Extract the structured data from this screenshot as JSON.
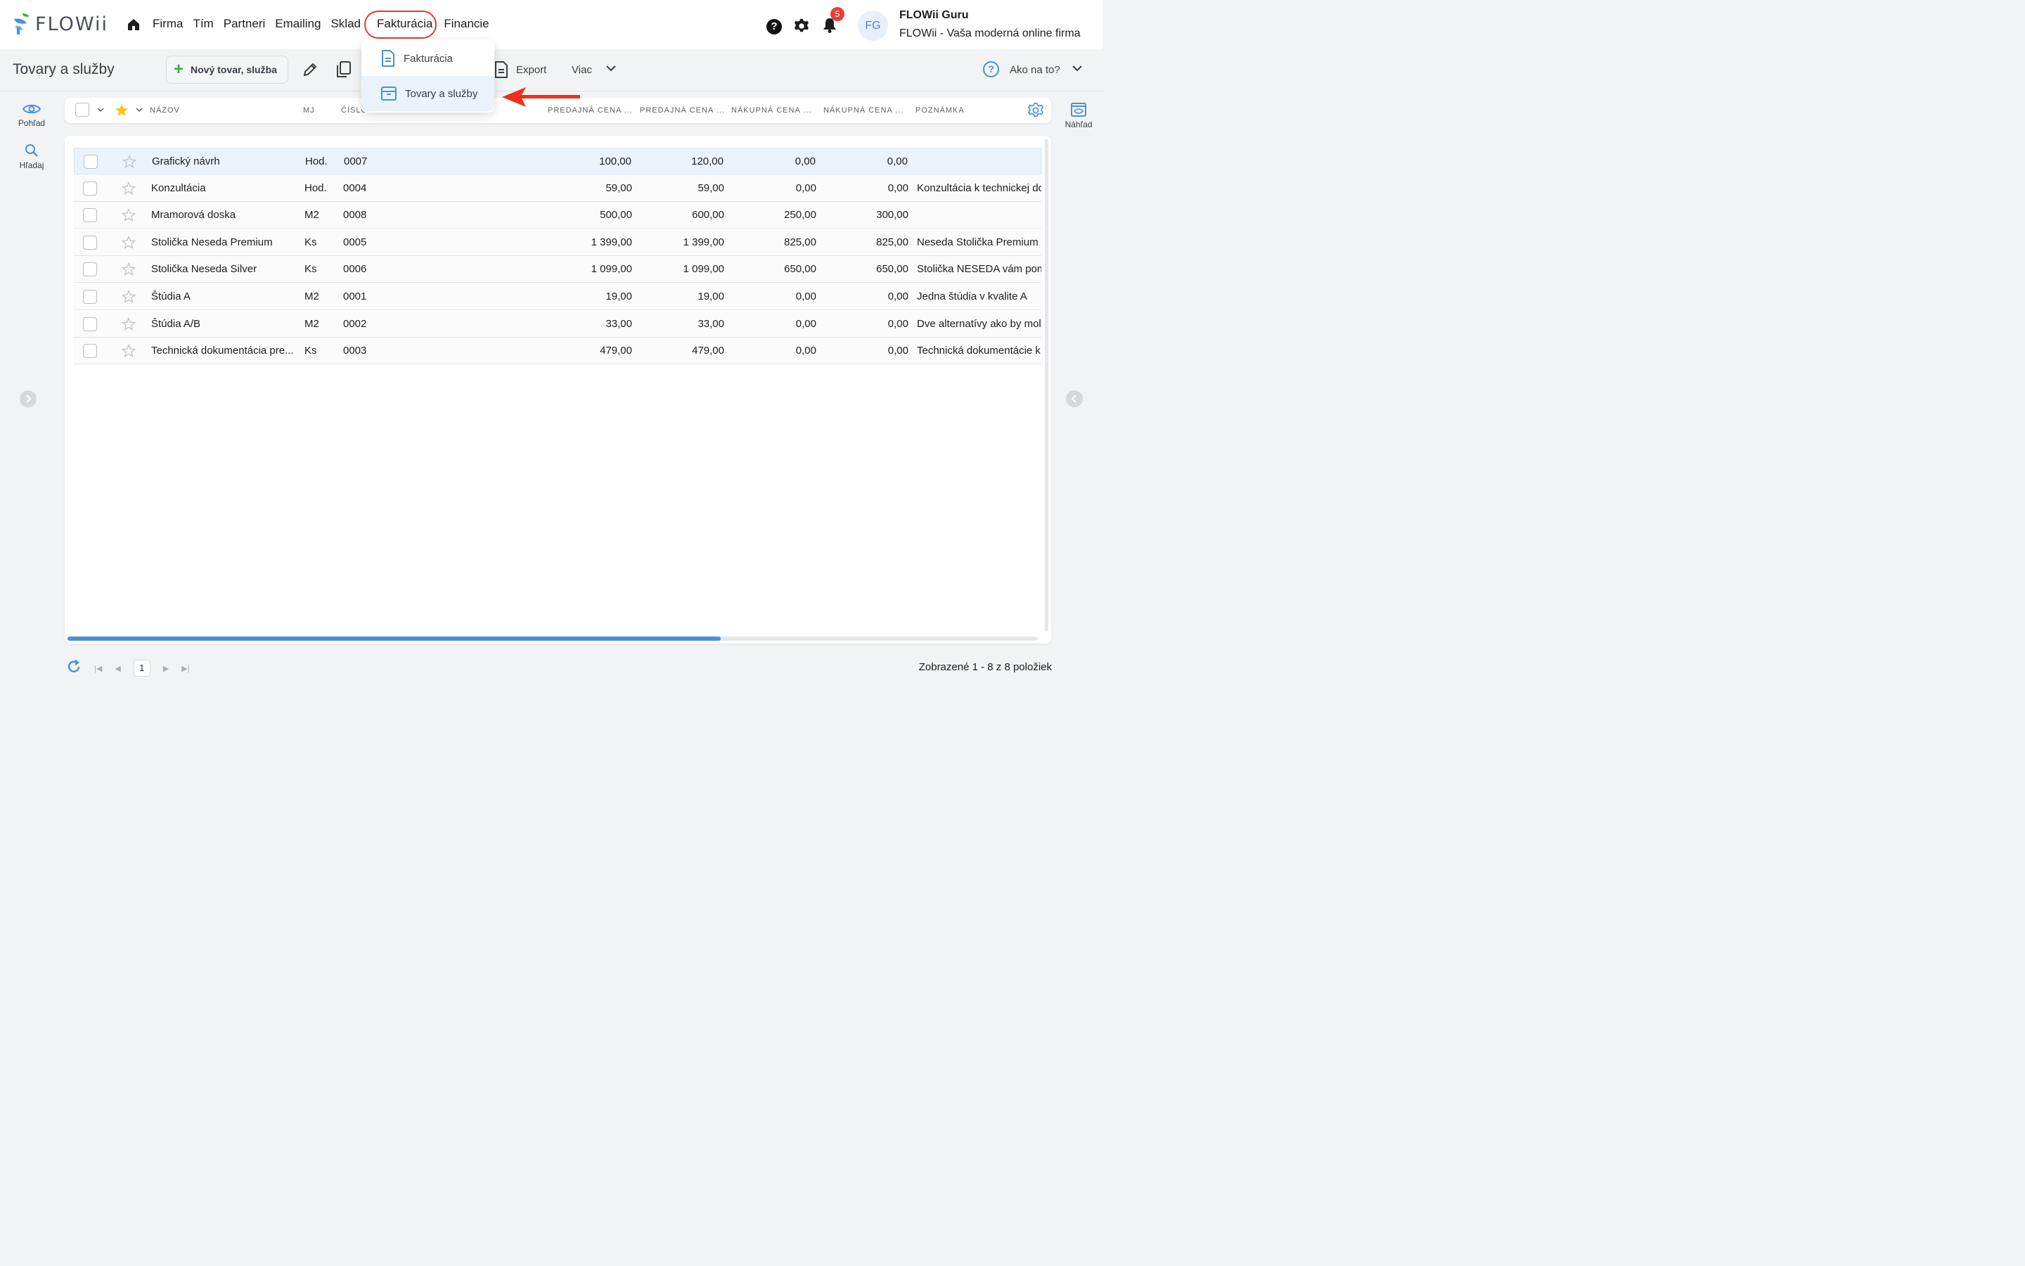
{
  "app": {
    "logo_text": "FLOWii",
    "nav": [
      "Firma",
      "Tím",
      "Partneri",
      "Emailing",
      "Sklad",
      "Fakturácia",
      "Financie"
    ],
    "help_label": "?",
    "notifications_count": "5",
    "avatar_initials": "FG",
    "user_name": "FLOWii Guru",
    "user_company": "FLOWii - Vaša moderná online firma"
  },
  "toolbar": {
    "title": "Tovary a služby",
    "new_label": "Nový tovar, služba",
    "export_label": "Export",
    "more_label": "Viac",
    "howto_label": "Ako na to?",
    "howto_icon": "?"
  },
  "dropdown": {
    "items": [
      "Fakturácia",
      "Tovary a služby"
    ]
  },
  "side": {
    "view_label": "Pohľad",
    "search_label": "Hľadaj",
    "preview_label": "Náhľad"
  },
  "table": {
    "headers": {
      "name": "NÁZOV",
      "unit": "MJ",
      "number": "ČÍSLO",
      "price1": "PREDAJNÁ CENA ...",
      "price2": "PREDAJNÁ CENA ...",
      "buy1": "NÁKUPNÁ CENA ...",
      "buy2": "NÁKUPNÁ CENA ...",
      "note": "POZNÁMKA"
    },
    "rows": [
      {
        "name": "Grafický návrh",
        "unit": "Hod.",
        "number": "0007",
        "p1": "100,00",
        "p2": "120,00",
        "b1": "0,00",
        "b2": "0,00",
        "note": ""
      },
      {
        "name": "Konzultácia",
        "unit": "Hod.",
        "number": "0004",
        "p1": "59,00",
        "p2": "59,00",
        "b1": "0,00",
        "b2": "0,00",
        "note": "Konzultácia k technickej do"
      },
      {
        "name": "Mramorová doska",
        "unit": "M2",
        "number": "0008",
        "p1": "500,00",
        "p2": "600,00",
        "b1": "250,00",
        "b2": "300,00",
        "note": ""
      },
      {
        "name": "Stolička Neseda Premium",
        "unit": "Ks",
        "number": "0005",
        "p1": "1 399,00",
        "p2": "1 399,00",
        "b1": "825,00",
        "b2": "825,00",
        "note": "Neseda Stolička Premium -"
      },
      {
        "name": "Stolička Neseda Silver",
        "unit": "Ks",
        "number": "0006",
        "p1": "1 099,00",
        "p2": "1 099,00",
        "b1": "650,00",
        "b2": "650,00",
        "note": "Stolička NESEDA vám pom"
      },
      {
        "name": "Štúdia A",
        "unit": "M2",
        "number": "0001",
        "p1": "19,00",
        "p2": "19,00",
        "b1": "0,00",
        "b2": "0,00",
        "note": "Jedna štúdia v kvalite A"
      },
      {
        "name": "Štúdia A/B",
        "unit": "M2",
        "number": "0002",
        "p1": "33,00",
        "p2": "33,00",
        "b1": "0,00",
        "b2": "0,00",
        "note": "Dve alternatívy ako by mol"
      },
      {
        "name": "Technická dokumentácia pre...",
        "unit": "Ks",
        "number": "0003",
        "p1": "479,00",
        "p2": "479,00",
        "b1": "0,00",
        "b2": "0,00",
        "note": "Technická dokumentácie k"
      }
    ]
  },
  "footer": {
    "current_page": "1",
    "info": "Zobrazené 1 - 8 z 8 položiek"
  },
  "colors": {
    "accent": "#4a90d9",
    "highlight": "#e23c2a",
    "add": "#3fae3a"
  }
}
